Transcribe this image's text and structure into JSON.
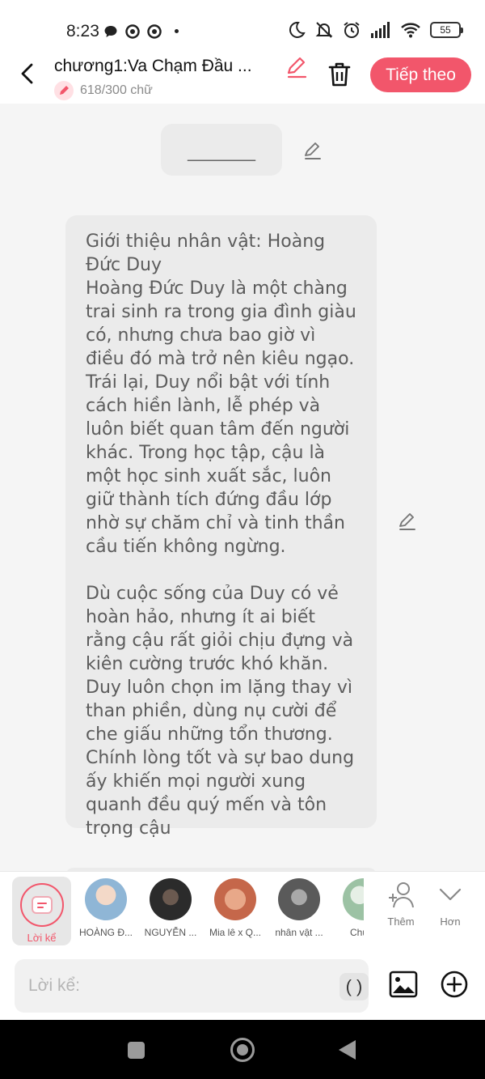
{
  "status": {
    "time": "8:23",
    "battery": "55",
    "left_icons": [
      "chat-bubble-icon",
      "chrome-icon",
      "chrome-icon"
    ],
    "right_icons": [
      "moon-icon",
      "bell-off-icon",
      "alarm-icon",
      "signal-icon",
      "wifi-icon"
    ]
  },
  "header": {
    "title": "chương1:Va Chạm Đầu ...",
    "word_count": "618/300 chữ",
    "next_label": "Tiếp theo",
    "accent": "#f2566b"
  },
  "content": {
    "title_placeholder": "________",
    "message": "Giới thiệu nhân vật: Hoàng Đức Duy\nHoàng Đức Duy là một chàng trai sinh ra trong gia đình giàu có, nhưng chưa bao giờ vì điều đó mà trở nên kiêu ngạo. Trái lại, Duy nổi bật với tính cách hiền lành, lễ phép và luôn biết quan tâm đến người khác. Trong học tập, cậu là một học sinh xuất sắc, luôn giữ thành tích đứng đầu lớp nhờ sự chăm chỉ và tinh thần cầu tiến không ngừng.\n\nDù cuộc sống của Duy có vẻ hoàn hảo, nhưng ít ai biết rằng cậu rất giỏi chịu đựng và kiên cường trước khó khăn. Duy luôn chọn im lặng thay vì than phiền, dùng nụ cười để che giấu những tổn thương. Chính lòng tốt và sự bao dung ấy khiến mọi người xung quanh đều quý mến và tôn trọng cậu"
  },
  "characters": {
    "narrator_label": "Lời kể",
    "items": [
      {
        "label": "HOÀNG Đ...",
        "color": "#8fb6d6"
      },
      {
        "label": "NGUYỄN ...",
        "color": "#2b2b2b"
      },
      {
        "label": "Mia lê x Q...",
        "color": "#c5674a"
      },
      {
        "label": "nhân vật ...",
        "color": "#5a5a5a"
      },
      {
        "label": "Chủ N",
        "color": "#9cc2a4"
      }
    ],
    "add_label": "Thêm",
    "more_label": "Hơn"
  },
  "input": {
    "placeholder": "Lời kể:",
    "paren_label": "( )"
  }
}
